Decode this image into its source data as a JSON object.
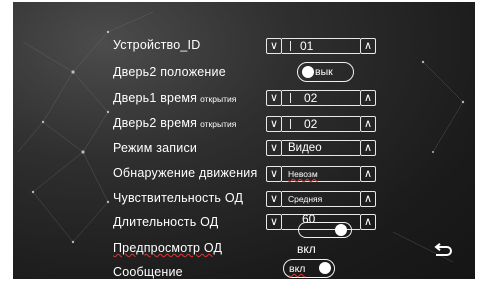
{
  "settings": {
    "rows": [
      {
        "label": "Устройство_ID",
        "value": "01"
      },
      {
        "label": "Дверь2 положение",
        "value": "вык"
      },
      {
        "label": "Дверь1 время",
        "label_small": "открытия",
        "value": "02"
      },
      {
        "label": "Дверь2 время",
        "label_small": "открытия",
        "value": "02"
      },
      {
        "label": "Режим записи",
        "value": "Видео"
      },
      {
        "label": "Обнаружение движения",
        "value": "Невозм"
      },
      {
        "label": "Чувствительность ОД",
        "value": "Средняя"
      },
      {
        "label": "Длительность ОД",
        "value": "60"
      },
      {
        "label": "Предпросмотр ОД",
        "value": "вкл"
      },
      {
        "label": "Сообщение",
        "value": "вкл"
      }
    ]
  },
  "icons": {
    "decrease": "chevron-down-icon",
    "increase": "chevron-up-icon",
    "back": "return-arrow-icon"
  },
  "colors": {
    "background": "#1f1f1f",
    "foreground": "#ffffff",
    "spellcheck_underline": "#dd3333"
  }
}
